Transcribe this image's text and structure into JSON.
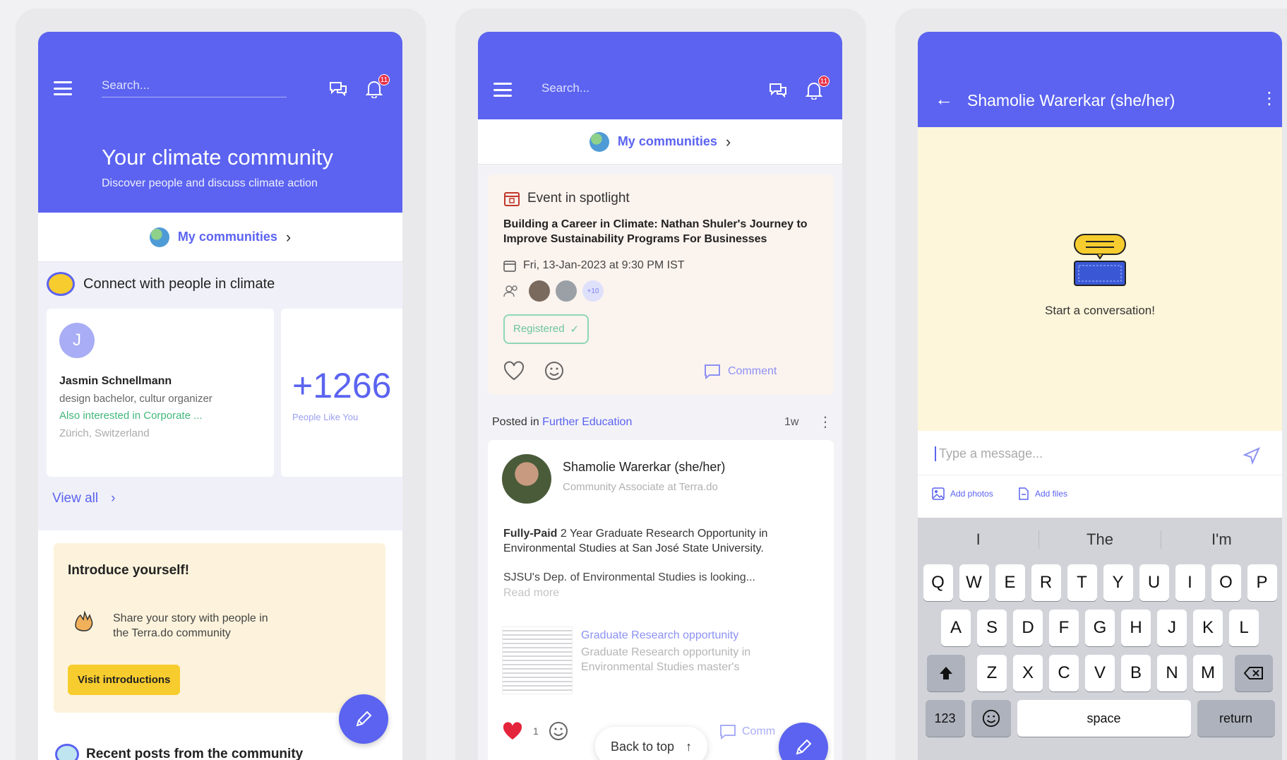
{
  "common": {
    "search_placeholder": "Search...",
    "notification_count": "11",
    "my_communities": "My communities"
  },
  "screen1": {
    "hero_title": "Your climate community",
    "hero_subtitle": "Discover people and discuss climate action",
    "connect_heading": "Connect with people in climate",
    "person": {
      "initial": "J",
      "name": "Jasmin Schnellmann",
      "role": "design bachelor, cultur organizer",
      "interest": "Also interested in Corporate ...",
      "location": "Zürich, Switzerland"
    },
    "people_count": "+1266",
    "people_like_you": "People Like You",
    "view_all": "View all",
    "intro": {
      "title": "Introduce yourself!",
      "text": "Share your story with people in the Terra.do community",
      "button": "Visit introductions"
    },
    "recent_posts": "Recent posts from the community"
  },
  "screen2": {
    "spotlight_label": "Event in spotlight",
    "event_title": "Building a Career in Climate: Nathan Shuler's Journey to Improve Sustainability Programs For Businesses",
    "event_date": "Fri, 13-Jan-2023 at 9:30 PM IST",
    "attendees_more": "+10",
    "registered": "Registered",
    "comment": "Comment",
    "posted_in_prefix": "Posted in",
    "posted_in_group": "Further Education",
    "posted_age": "1w",
    "author_name": "Shamolie Warerkar (she/her)",
    "author_role": "Community Associate at Terra.do",
    "post_bold": "Fully-Paid",
    "post_text": "2 Year Graduate Research Opportunity in Environmental Studies at San José State University.",
    "post_body": "SJSU's Dep. of Environmental Studies is looking...",
    "read_more": "Read more",
    "link_title": "Graduate Research opportunity",
    "link_desc": "Graduate Research opportunity in Environmental Studies master's",
    "like_count": "1",
    "back_to_top": "Back to top",
    "comment_partial": "Comm"
  },
  "screen3": {
    "chat_title": "Shamolie Warerkar (she/her)",
    "empty_state": "Start a conversation!",
    "message_placeholder": "Type a message...",
    "add_photos": "Add photos",
    "add_files": "Add files",
    "suggestions": [
      "I",
      "The",
      "I'm"
    ],
    "row1": [
      "Q",
      "W",
      "E",
      "R",
      "T",
      "Y",
      "U",
      "I",
      "O",
      "P"
    ],
    "row2": [
      "A",
      "S",
      "D",
      "F",
      "G",
      "H",
      "J",
      "K",
      "L"
    ],
    "row3": [
      "Z",
      "X",
      "C",
      "V",
      "B",
      "N",
      "M"
    ],
    "key_123": "123",
    "key_space": "space",
    "key_return": "return"
  },
  "colors": {
    "brand": "#5b63f0",
    "yellow_button": "#f7cc2e",
    "intro_bg": "#fdf3dc",
    "spotlight_bg": "#fbf3ee",
    "chat_bg": "#fdf6da",
    "like_red": "#e3243b"
  }
}
